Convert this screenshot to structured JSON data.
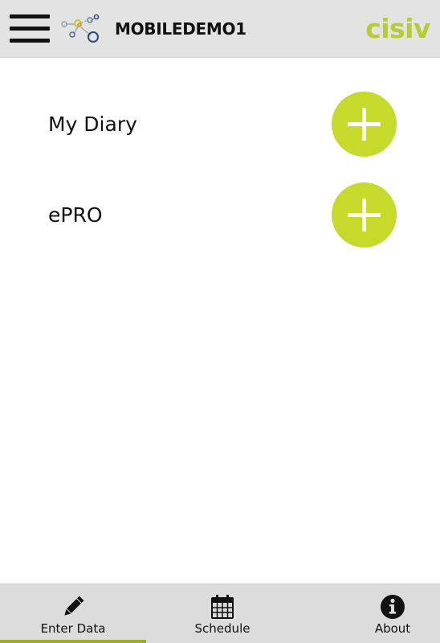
{
  "header": {
    "title": "MOBILEDEMO1",
    "brand": "cisiv",
    "menu_icon": "hamburger-menu-icon",
    "logo_icon": "network-molecule-logo"
  },
  "entries": [
    {
      "label": "My Diary",
      "action_icon": "plus-icon"
    },
    {
      "label": "ePRO",
      "action_icon": "plus-icon"
    }
  ],
  "tabs": [
    {
      "label": "Enter Data",
      "icon": "pencil-icon",
      "active": true
    },
    {
      "label": "Schedule",
      "icon": "calendar-icon",
      "active": false
    },
    {
      "label": "About",
      "icon": "info-icon",
      "active": false
    }
  ],
  "colors": {
    "header_bg": "#e3e3e3",
    "brand": "#b7cc2e",
    "add_button": "#c5da2a",
    "active_tab_indicator": "#9dae1f",
    "tabbar_bg": "#dcdcdc"
  }
}
